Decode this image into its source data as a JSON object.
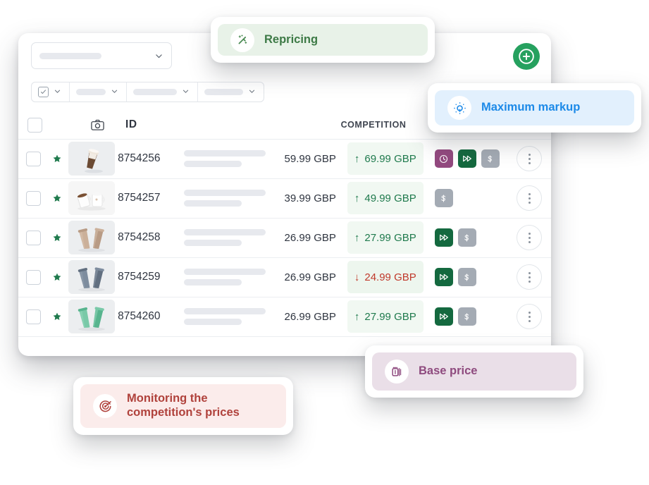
{
  "card": {
    "top_select": {
      "placeholder": "",
      "chevron_icon": "chevron-down-icon"
    },
    "filters": [
      {
        "icon": "checkbox-dropdown-icon",
        "label": ""
      },
      {
        "label": ""
      },
      {
        "label": ""
      },
      {
        "label": ""
      }
    ],
    "add_button": {
      "icon": "plus-circle-icon",
      "label": ""
    }
  },
  "table": {
    "columns": {
      "select": "",
      "photo": "camera-icon",
      "id": "ID",
      "description": "",
      "price": "",
      "competition": "COMPETITION",
      "tags": "",
      "actions": ""
    },
    "rows": [
      {
        "id": "8754256",
        "price": "59.99 GBP",
        "competition": "69.99 GBP",
        "direction": "up",
        "arrow": "↑",
        "starred": true,
        "product": "coffee-cup-brown",
        "tags": [
          "clock-icon",
          "fast-forward-icon",
          "dollar-icon"
        ]
      },
      {
        "id": "8754257",
        "price": "39.99 GBP",
        "competition": "49.99 GBP",
        "direction": "up",
        "arrow": "↑",
        "starred": true,
        "product": "mugs-white",
        "tags": [
          "dollar-icon"
        ]
      },
      {
        "id": "8754258",
        "price": "26.99 GBP",
        "competition": "27.99 GBP",
        "direction": "up",
        "arrow": "↑",
        "starred": true,
        "product": "tumblers-tan",
        "tags": [
          "fast-forward-icon",
          "dollar-icon"
        ]
      },
      {
        "id": "8754259",
        "price": "26.99 GBP",
        "competition": "24.99 GBP",
        "direction": "down",
        "arrow": "↓",
        "starred": true,
        "product": "tumblers-blue",
        "tags": [
          "fast-forward-icon",
          "dollar-icon"
        ]
      },
      {
        "id": "8754260",
        "price": "26.99 GBP",
        "competition": "27.99 GBP",
        "direction": "up",
        "arrow": "↑",
        "starred": true,
        "product": "tumblers-green",
        "tags": [
          "fast-forward-icon",
          "dollar-icon"
        ]
      }
    ]
  },
  "chips": {
    "repricing": {
      "label": "Repricing",
      "icon": "magic-wand-icon"
    },
    "maximum_markup": {
      "label": "Maximum markup",
      "icon": "sun-brightness-icon"
    },
    "base_price": {
      "label": "Base price",
      "icon": "price-tag-stack-icon"
    },
    "monitoring": {
      "label_line1": "Monitoring the",
      "label_line2": "competition's prices",
      "icon": "target-icon"
    }
  },
  "colors": {
    "accent_green": "#26a15f",
    "tag_purple": "#93497f",
    "tag_green": "#14693f",
    "tag_gray": "#a4abb4",
    "up_green": "#1f7a4d",
    "down_red": "#c0392b",
    "chip_markup_blue": "#1d8ae8",
    "chip_base_purple": "#8e4a7e",
    "chip_monitor_red": "#b0423c",
    "chip_repricing_green": "#3d7a46"
  }
}
